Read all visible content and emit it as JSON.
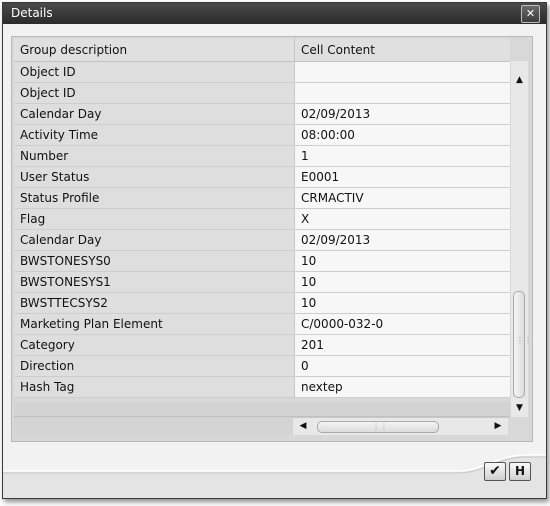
{
  "window": {
    "title": "Details",
    "close_glyph": "✕"
  },
  "table": {
    "headers": [
      "Group description",
      "Cell Content"
    ],
    "rows": [
      [
        "Object ID",
        ""
      ],
      [
        "Object ID",
        ""
      ],
      [
        "Calendar Day",
        "02/09/2013"
      ],
      [
        "Activity Time",
        "08:00:00"
      ],
      [
        "Number",
        "1"
      ],
      [
        "User Status",
        "E0001"
      ],
      [
        "Status Profile",
        "CRMACTIV"
      ],
      [
        "Flag",
        "X"
      ],
      [
        "Calendar Day",
        "02/09/2013"
      ],
      [
        "BWSTONESYS0",
        "10"
      ],
      [
        "BWSTONESYS1",
        "10"
      ],
      [
        "BWSTTECSYS2",
        "10"
      ],
      [
        "Marketing Plan Element",
        "C/0000-032-0"
      ],
      [
        "Category",
        "201"
      ],
      [
        "Direction",
        "0"
      ],
      [
        "Hash Tag",
        "nextep"
      ]
    ]
  },
  "scroll": {
    "up_icon": "▲",
    "down_icon": "▼",
    "left_icon": "◀",
    "right_icon": "▶",
    "grip": "⋮⋮"
  },
  "buttons": {
    "ok_icon": "✔",
    "help_icon": "H"
  }
}
